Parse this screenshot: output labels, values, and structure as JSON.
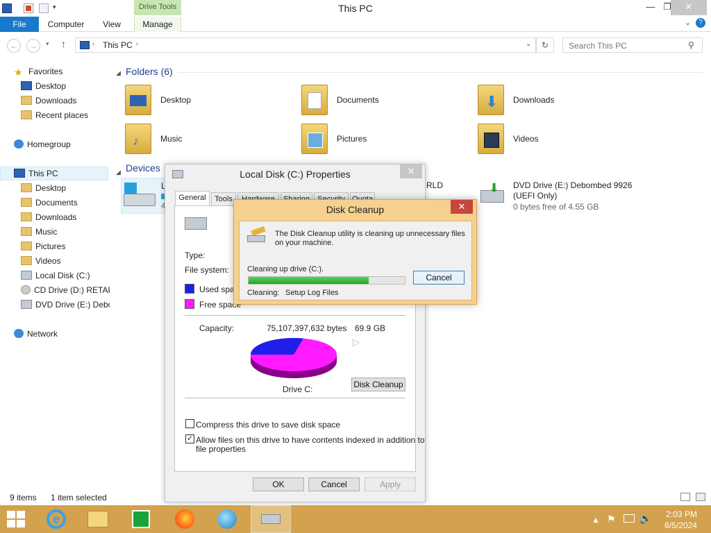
{
  "window": {
    "title": "This PC",
    "drive_tools_label": "Drive Tools"
  },
  "ribbon": {
    "tabs": [
      "File",
      "Computer",
      "View",
      "Manage"
    ]
  },
  "address": {
    "path": "This PC",
    "search_placeholder": "Search This PC"
  },
  "nav": {
    "favorites": {
      "label": "Favorites",
      "items": [
        "Desktop",
        "Downloads",
        "Recent places"
      ]
    },
    "homegroup": "Homegroup",
    "this_pc": {
      "label": "This PC",
      "items": [
        "Desktop",
        "Documents",
        "Downloads",
        "Music",
        "Pictures",
        "Videos",
        "Local Disk (C:)",
        "CD Drive (D:) RETAP",
        "DVD Drive (E:) Debo"
      ]
    },
    "network": "Network"
  },
  "content": {
    "folders_title": "Folders (6)",
    "folders": [
      "Desktop",
      "Documents",
      "Downloads",
      "Music",
      "Pictures",
      "Videos"
    ],
    "devices_title": "Devices",
    "devices": {
      "partial_label_1": "L",
      "partial_label_2": "4",
      "partial_label_3": "RLD",
      "dvd_name": "DVD Drive (E:) Debombed 9926",
      "dvd_sub": "(UEFI Only)",
      "dvd_free": "0 bytes free of 4.55 GB"
    }
  },
  "properties": {
    "title": "Local Disk (C:) Properties",
    "tabs": [
      "General",
      "Tools",
      "Hardware",
      "Sharing",
      "Security",
      "Quota"
    ],
    "type_label": "Type:",
    "fs_label": "File system:",
    "used_label": "Used spac",
    "free_label": "Free space",
    "capacity_label": "Capacity:",
    "capacity_bytes": "75,107,397,632 bytes",
    "capacity_gb": "69.9 GB",
    "drive_label": "Drive C:",
    "disk_cleanup_button": "Disk Cleanup",
    "compress_label": "Compress this drive to save disk space",
    "compress_checked": false,
    "index_label_line1": "Allow files on this drive to have contents indexed in addition to",
    "index_label_line2": "file properties",
    "index_checked": true,
    "ok": "OK",
    "cancel": "Cancel",
    "apply": "Apply",
    "used_color": "#1f1fe8",
    "free_color": "#ff1aff"
  },
  "cleanup": {
    "title": "Disk Cleanup",
    "message_line1": "The Disk Cleanup utility is cleaning up unnecessary files",
    "message_line2": "on your machine.",
    "drive_text": "Cleaning up drive  (C:).",
    "cancel": "Cancel",
    "progress": 0.77,
    "cleaning_label": "Cleaning:",
    "cleaning_value": "Setup Log Files"
  },
  "status": {
    "items_count": "9 items",
    "selected": "1 item selected"
  },
  "taskbar": {
    "time": "2:03 PM",
    "date": "6/5/2024"
  }
}
